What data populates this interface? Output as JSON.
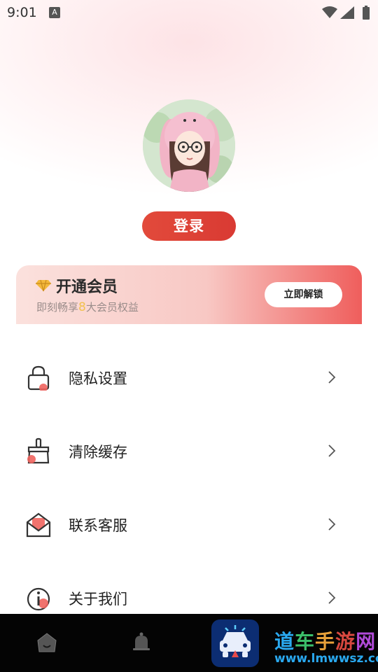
{
  "status_bar": {
    "time": "9:01",
    "notification_letter": "A",
    "icons": [
      "wifi-icon",
      "signal-icon",
      "battery-icon"
    ]
  },
  "profile": {
    "login_label": "登录"
  },
  "vip": {
    "title": "开通会员",
    "subtitle_prefix": "即刻畅享",
    "subtitle_number": "8",
    "subtitle_suffix": "大会员权益",
    "button_label": "立即解锁"
  },
  "menu": {
    "items": [
      {
        "label": "隐私设置",
        "icon": "lock-icon"
      },
      {
        "label": "清除缓存",
        "icon": "broom-icon"
      },
      {
        "label": "联系客服",
        "icon": "envelope-icon"
      },
      {
        "label": "关于我们",
        "icon": "info-icon"
      }
    ]
  },
  "bottom_nav": {
    "icons": [
      "home-icon",
      "bell-icon"
    ]
  },
  "watermark": {
    "text_chars": [
      "道",
      "车",
      "手",
      "游",
      "网"
    ],
    "url": "www.lmwwsz.com"
  },
  "colors": {
    "accent": "#e0443a",
    "vip_number": "#f1c14f",
    "bottom_bar": "#040404"
  }
}
